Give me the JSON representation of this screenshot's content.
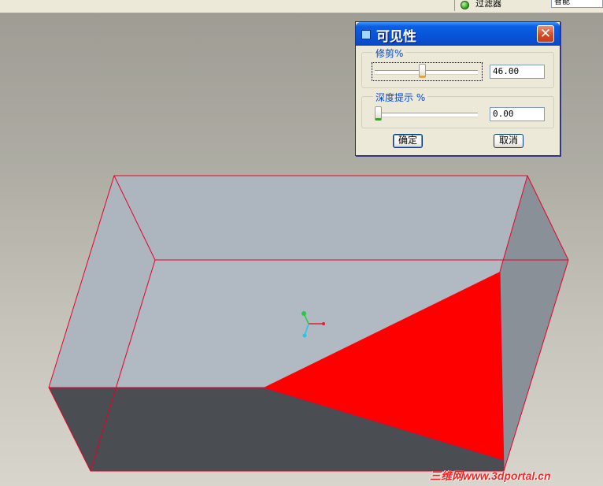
{
  "toolbar": {
    "filter_label": "过滤器",
    "filter_value": "智能"
  },
  "dialog": {
    "title": "可见性",
    "clip_group": {
      "label": "修剪%",
      "value": "46.00",
      "percent": 46
    },
    "depth_group": {
      "label": "深度提示 %",
      "value": "0.00",
      "percent": 0
    },
    "ok_label": "确定",
    "cancel_label": "取消",
    "close_symbol": "✕"
  },
  "viewport": {
    "colors": {
      "top_face": "#adb6bf",
      "side_face": "#8a9098",
      "front_face": "#4a4d51",
      "section_fill": "#ff0000",
      "edge": "#e8002a"
    },
    "csys": {
      "x_color": "#e02030",
      "y_color": "#22cc44",
      "z_color": "#22c8e8"
    }
  },
  "watermark": "三维网www.3dportal.cn",
  "icons": {
    "status": "status-green-light-icon",
    "app": "dialog-app-icon",
    "close": "close-icon"
  }
}
